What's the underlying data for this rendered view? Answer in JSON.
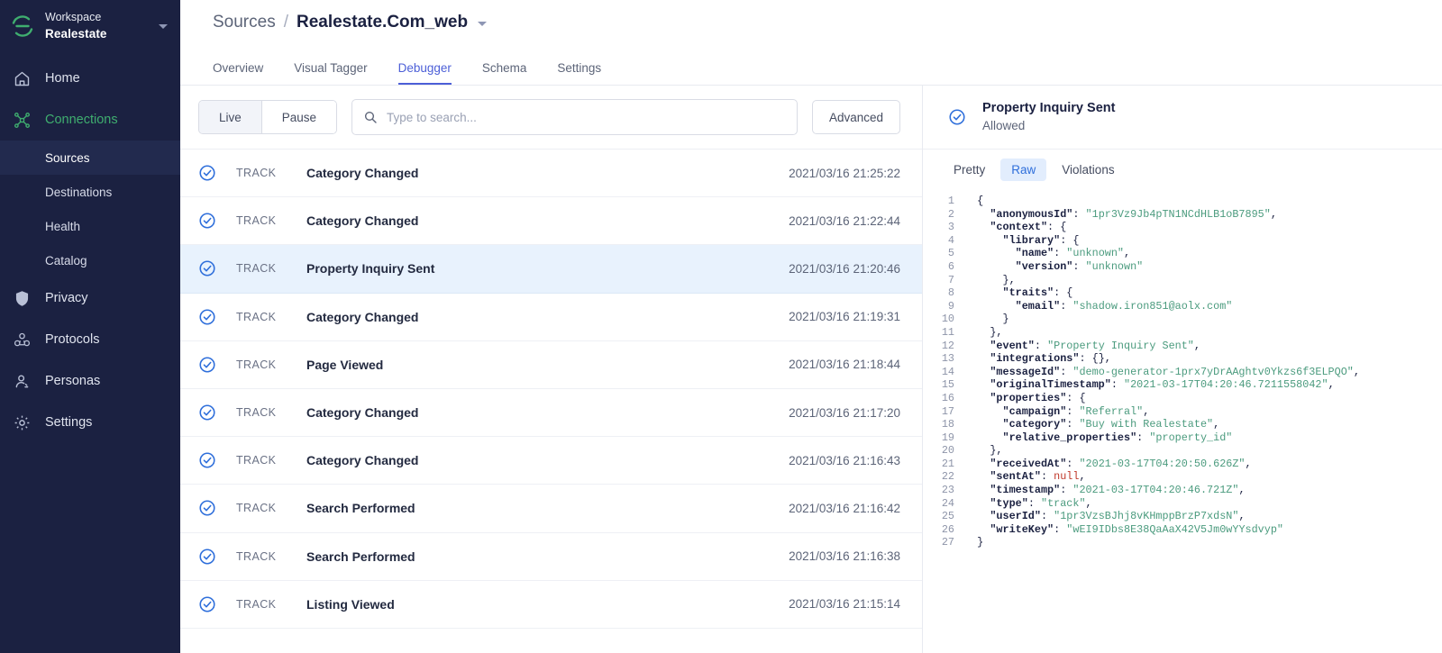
{
  "sidebar": {
    "workspace": {
      "label": "Workspace",
      "name": "Realestate"
    },
    "items": [
      {
        "label": "Home",
        "icon": "home-icon",
        "active": false
      },
      {
        "label": "Connections",
        "icon": "connections-icon",
        "active": true
      },
      {
        "label": "Privacy",
        "icon": "shield-icon",
        "active": false
      },
      {
        "label": "Protocols",
        "icon": "protocols-icon",
        "active": false
      },
      {
        "label": "Personas",
        "icon": "person-icon",
        "active": false
      },
      {
        "label": "Settings",
        "icon": "gear-icon",
        "active": false
      }
    ],
    "sub_items": [
      {
        "label": "Sources",
        "selected": true
      },
      {
        "label": "Destinations",
        "selected": false
      },
      {
        "label": "Health",
        "selected": false
      },
      {
        "label": "Catalog",
        "selected": false
      }
    ]
  },
  "header": {
    "breadcrumb_root": "Sources",
    "breadcrumb_sep": "/",
    "breadcrumb_current": "Realestate.Com_web",
    "tabs": [
      {
        "label": "Overview",
        "active": false
      },
      {
        "label": "Visual Tagger",
        "active": false
      },
      {
        "label": "Debugger",
        "active": true
      },
      {
        "label": "Schema",
        "active": false
      },
      {
        "label": "Settings",
        "active": false
      }
    ]
  },
  "toolbar": {
    "live_label": "Live",
    "pause_label": "Pause",
    "search_placeholder": "Type to search...",
    "search_value": "",
    "advanced_label": "Advanced"
  },
  "events": [
    {
      "type": "TRACK",
      "name": "Category Changed",
      "timestamp": "2021/03/16 21:25:22",
      "selected": false
    },
    {
      "type": "TRACK",
      "name": "Category Changed",
      "timestamp": "2021/03/16 21:22:44",
      "selected": false
    },
    {
      "type": "TRACK",
      "name": "Property Inquiry Sent",
      "timestamp": "2021/03/16 21:20:46",
      "selected": true
    },
    {
      "type": "TRACK",
      "name": "Category Changed",
      "timestamp": "2021/03/16 21:19:31",
      "selected": false
    },
    {
      "type": "TRACK",
      "name": "Page Viewed",
      "timestamp": "2021/03/16 21:18:44",
      "selected": false
    },
    {
      "type": "TRACK",
      "name": "Category Changed",
      "timestamp": "2021/03/16 21:17:20",
      "selected": false
    },
    {
      "type": "TRACK",
      "name": "Category Changed",
      "timestamp": "2021/03/16 21:16:43",
      "selected": false
    },
    {
      "type": "TRACK",
      "name": "Search Performed",
      "timestamp": "2021/03/16 21:16:42",
      "selected": false
    },
    {
      "type": "TRACK",
      "name": "Search Performed",
      "timestamp": "2021/03/16 21:16:38",
      "selected": false
    },
    {
      "type": "TRACK",
      "name": "Listing Viewed",
      "timestamp": "2021/03/16 21:15:14",
      "selected": false
    }
  ],
  "detail": {
    "title": "Property Inquiry Sent",
    "status": "Allowed",
    "tabs": [
      {
        "label": "Pretty",
        "active": false
      },
      {
        "label": "Raw",
        "active": true
      },
      {
        "label": "Violations",
        "active": false
      }
    ],
    "code_lines": [
      {
        "n": 1,
        "segs": [
          {
            "t": "{",
            "c": "p"
          }
        ],
        "indent": 0
      },
      {
        "n": 2,
        "segs": [
          {
            "t": "\"anonymousId\"",
            "c": "k"
          },
          {
            "t": ": ",
            "c": "p"
          },
          {
            "t": "\"1pr3Vz9Jb4pTN1NCdHLB1oB7895\"",
            "c": "s"
          },
          {
            "t": ",",
            "c": "p"
          }
        ],
        "indent": 1
      },
      {
        "n": 3,
        "segs": [
          {
            "t": "\"context\"",
            "c": "k"
          },
          {
            "t": ": {",
            "c": "p"
          }
        ],
        "indent": 1
      },
      {
        "n": 4,
        "segs": [
          {
            "t": "\"library\"",
            "c": "k"
          },
          {
            "t": ": {",
            "c": "p"
          }
        ],
        "indent": 2
      },
      {
        "n": 5,
        "segs": [
          {
            "t": "\"name\"",
            "c": "k"
          },
          {
            "t": ": ",
            "c": "p"
          },
          {
            "t": "\"unknown\"",
            "c": "s"
          },
          {
            "t": ",",
            "c": "p"
          }
        ],
        "indent": 3
      },
      {
        "n": 6,
        "segs": [
          {
            "t": "\"version\"",
            "c": "k"
          },
          {
            "t": ": ",
            "c": "p"
          },
          {
            "t": "\"unknown\"",
            "c": "s"
          }
        ],
        "indent": 3
      },
      {
        "n": 7,
        "segs": [
          {
            "t": "},",
            "c": "p"
          }
        ],
        "indent": 2
      },
      {
        "n": 8,
        "segs": [
          {
            "t": "\"traits\"",
            "c": "k"
          },
          {
            "t": ": {",
            "c": "p"
          }
        ],
        "indent": 2
      },
      {
        "n": 9,
        "segs": [
          {
            "t": "\"email\"",
            "c": "k"
          },
          {
            "t": ": ",
            "c": "p"
          },
          {
            "t": "\"shadow.iron851@aolx.com\"",
            "c": "s"
          }
        ],
        "indent": 3
      },
      {
        "n": 10,
        "segs": [
          {
            "t": "}",
            "c": "p"
          }
        ],
        "indent": 2
      },
      {
        "n": 11,
        "segs": [
          {
            "t": "},",
            "c": "p"
          }
        ],
        "indent": 1
      },
      {
        "n": 12,
        "segs": [
          {
            "t": "\"event\"",
            "c": "k"
          },
          {
            "t": ": ",
            "c": "p"
          },
          {
            "t": "\"Property Inquiry Sent\"",
            "c": "s"
          },
          {
            "t": ",",
            "c": "p"
          }
        ],
        "indent": 1
      },
      {
        "n": 13,
        "segs": [
          {
            "t": "\"integrations\"",
            "c": "k"
          },
          {
            "t": ": {},",
            "c": "p"
          }
        ],
        "indent": 1
      },
      {
        "n": 14,
        "segs": [
          {
            "t": "\"messageId\"",
            "c": "k"
          },
          {
            "t": ": ",
            "c": "p"
          },
          {
            "t": "\"demo-generator-1prx7yDrAAghtv0Ykzs6f3ELPQO\"",
            "c": "s"
          },
          {
            "t": ",",
            "c": "p"
          }
        ],
        "indent": 1
      },
      {
        "n": 15,
        "segs": [
          {
            "t": "\"originalTimestamp\"",
            "c": "k"
          },
          {
            "t": ": ",
            "c": "p"
          },
          {
            "t": "\"2021-03-17T04:20:46.7211558042\"",
            "c": "s"
          },
          {
            "t": ",",
            "c": "p"
          }
        ],
        "indent": 1
      },
      {
        "n": 16,
        "segs": [
          {
            "t": "\"properties\"",
            "c": "k"
          },
          {
            "t": ": {",
            "c": "p"
          }
        ],
        "indent": 1
      },
      {
        "n": 17,
        "segs": [
          {
            "t": "\"campaign\"",
            "c": "k"
          },
          {
            "t": ": ",
            "c": "p"
          },
          {
            "t": "\"Referral\"",
            "c": "s"
          },
          {
            "t": ",",
            "c": "p"
          }
        ],
        "indent": 2
      },
      {
        "n": 18,
        "segs": [
          {
            "t": "\"category\"",
            "c": "k"
          },
          {
            "t": ": ",
            "c": "p"
          },
          {
            "t": "\"Buy with Realestate\"",
            "c": "s"
          },
          {
            "t": ",",
            "c": "p"
          }
        ],
        "indent": 2
      },
      {
        "n": 19,
        "segs": [
          {
            "t": "\"relative_properties\"",
            "c": "k"
          },
          {
            "t": ": ",
            "c": "p"
          },
          {
            "t": "\"property_id\"",
            "c": "s"
          }
        ],
        "indent": 2
      },
      {
        "n": 20,
        "segs": [
          {
            "t": "},",
            "c": "p"
          }
        ],
        "indent": 1
      },
      {
        "n": 21,
        "segs": [
          {
            "t": "\"receivedAt\"",
            "c": "k"
          },
          {
            "t": ": ",
            "c": "p"
          },
          {
            "t": "\"2021-03-17T04:20:50.626Z\"",
            "c": "s"
          },
          {
            "t": ",",
            "c": "p"
          }
        ],
        "indent": 1
      },
      {
        "n": 22,
        "segs": [
          {
            "t": "\"sentAt\"",
            "c": "k"
          },
          {
            "t": ": ",
            "c": "p"
          },
          {
            "t": "null",
            "c": "n"
          },
          {
            "t": ",",
            "c": "p"
          }
        ],
        "indent": 1
      },
      {
        "n": 23,
        "segs": [
          {
            "t": "\"timestamp\"",
            "c": "k"
          },
          {
            "t": ": ",
            "c": "p"
          },
          {
            "t": "\"2021-03-17T04:20:46.721Z\"",
            "c": "s"
          },
          {
            "t": ",",
            "c": "p"
          }
        ],
        "indent": 1
      },
      {
        "n": 24,
        "segs": [
          {
            "t": "\"type\"",
            "c": "k"
          },
          {
            "t": ": ",
            "c": "p"
          },
          {
            "t": "\"track\"",
            "c": "s"
          },
          {
            "t": ",",
            "c": "p"
          }
        ],
        "indent": 1
      },
      {
        "n": 25,
        "segs": [
          {
            "t": "\"userId\"",
            "c": "k"
          },
          {
            "t": ": ",
            "c": "p"
          },
          {
            "t": "\"1pr3VzsBJhj8vKHmppBrzP7xdsN\"",
            "c": "s"
          },
          {
            "t": ",",
            "c": "p"
          }
        ],
        "indent": 1
      },
      {
        "n": 26,
        "segs": [
          {
            "t": "\"writeKey\"",
            "c": "k"
          },
          {
            "t": ": ",
            "c": "p"
          },
          {
            "t": "\"wEI9IDbs8E38QaAaX42V5Jm0wYYsdvyp\"",
            "c": "s"
          }
        ],
        "indent": 1
      },
      {
        "n": 27,
        "segs": [
          {
            "t": "}",
            "c": "p"
          }
        ],
        "indent": 0
      }
    ]
  },
  "colors": {
    "sidebar_bg": "#1b2141",
    "accent_green": "#3fae6f",
    "accent_blue": "#4c5fd7",
    "check_blue": "#2f6fdb",
    "selected_row": "#e8f2fd",
    "string_green": "#4b9b7e"
  }
}
